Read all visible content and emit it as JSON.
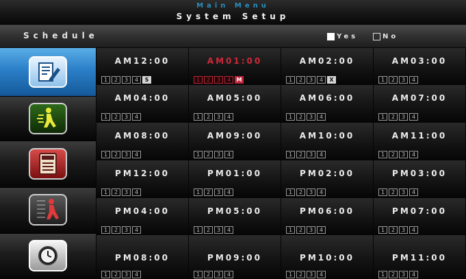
{
  "header": {
    "title": "Main Menu",
    "subtitle": "System Setup"
  },
  "schedule_bar": {
    "label": "Schedule",
    "yes_label": "Yes",
    "no_label": "No",
    "yes_checked": true,
    "no_checked": false
  },
  "sidebar": {
    "items": [
      {
        "icon": "schedule-edit-icon",
        "active": true
      },
      {
        "icon": "motion-person-icon",
        "active": false
      },
      {
        "icon": "storage-card-icon",
        "active": false
      },
      {
        "icon": "intruder-alert-icon",
        "active": false
      },
      {
        "icon": "clock-icon",
        "active": false
      }
    ]
  },
  "schedule": {
    "selected_index": 1,
    "slots": [
      {
        "time": "AM12:00",
        "channels": [
          "1",
          "2",
          "3",
          "4"
        ],
        "status": "S"
      },
      {
        "time": "AM01:00",
        "channels": [
          "1",
          "2",
          "3",
          "4"
        ],
        "status": "M"
      },
      {
        "time": "AM02:00",
        "channels": [
          "1",
          "2",
          "3",
          "4"
        ],
        "status": "X"
      },
      {
        "time": "AM03:00",
        "channels": [
          "1",
          "2",
          "3",
          "4"
        ],
        "status": ""
      },
      {
        "time": "AM04:00",
        "channels": [
          "1",
          "2",
          "3",
          "4"
        ],
        "status": ""
      },
      {
        "time": "AM05:00",
        "channels": [
          "1",
          "2",
          "3",
          "4"
        ],
        "status": ""
      },
      {
        "time": "AM06:00",
        "channels": [
          "1",
          "2",
          "3",
          "4"
        ],
        "status": ""
      },
      {
        "time": "AM07:00",
        "channels": [
          "1",
          "2",
          "3",
          "4"
        ],
        "status": ""
      },
      {
        "time": "AM08:00",
        "channels": [
          "1",
          "2",
          "3",
          "4"
        ],
        "status": ""
      },
      {
        "time": "AM09:00",
        "channels": [
          "1",
          "2",
          "3",
          "4"
        ],
        "status": ""
      },
      {
        "time": "AM10:00",
        "channels": [
          "1",
          "2",
          "3",
          "4"
        ],
        "status": ""
      },
      {
        "time": "AM11:00",
        "channels": [
          "1",
          "2",
          "3",
          "4"
        ],
        "status": ""
      },
      {
        "time": "PM12:00",
        "channels": [
          "1",
          "2",
          "3",
          "4"
        ],
        "status": ""
      },
      {
        "time": "PM01:00",
        "channels": [
          "1",
          "2",
          "3",
          "4"
        ],
        "status": ""
      },
      {
        "time": "PM02:00",
        "channels": [
          "1",
          "2",
          "3",
          "4"
        ],
        "status": ""
      },
      {
        "time": "PM03:00",
        "channels": [
          "1",
          "2",
          "3",
          "4"
        ],
        "status": ""
      },
      {
        "time": "PM04:00",
        "channels": [
          "1",
          "2",
          "3",
          "4"
        ],
        "status": ""
      },
      {
        "time": "PM05:00",
        "channels": [
          "1",
          "2",
          "3",
          "4"
        ],
        "status": ""
      },
      {
        "time": "PM06:00",
        "channels": [
          "1",
          "2",
          "3",
          "4"
        ],
        "status": ""
      },
      {
        "time": "PM07:00",
        "channels": [
          "1",
          "2",
          "3",
          "4"
        ],
        "status": ""
      },
      {
        "time": "PM08:00",
        "channels": [
          "1",
          "2",
          "3",
          "4"
        ],
        "status": ""
      },
      {
        "time": "PM09:00",
        "channels": [
          "1",
          "2",
          "3",
          "4"
        ],
        "status": ""
      },
      {
        "time": "PM10:00",
        "channels": [
          "1",
          "2",
          "3",
          "4"
        ],
        "status": ""
      },
      {
        "time": "PM11:00",
        "channels": [
          "1",
          "2",
          "3",
          "4"
        ],
        "status": ""
      }
    ]
  },
  "colors": {
    "accent_blue": "#2b7fc8",
    "selected_red": "#d0283a",
    "background": "#050505"
  }
}
